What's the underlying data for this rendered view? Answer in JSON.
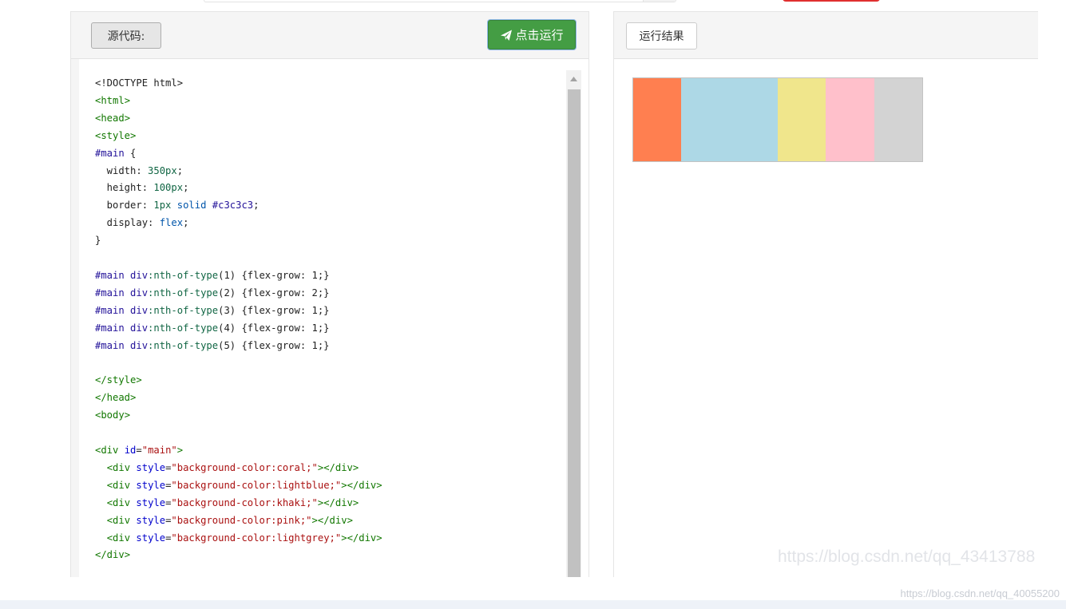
{
  "toolbar": {
    "source_label": "源代码:",
    "run_label": "点击运行",
    "result_label": "运行结果"
  },
  "editor": {
    "lines": [
      "<!DOCTYPE html>",
      "<html>",
      "<head>",
      "<style>",
      "#main {",
      "  width: 350px;",
      "  height: 100px;",
      "  border: 1px solid #c3c3c3;",
      "  display: flex;",
      "}",
      "",
      "#main div:nth-of-type(1) {flex-grow: 1;}",
      "#main div:nth-of-type(2) {flex-grow: 2;}",
      "#main div:nth-of-type(3) {flex-grow: 1;}",
      "#main div:nth-of-type(4) {flex-grow: 1;}",
      "#main div:nth-of-type(5) {flex-grow: 1;}",
      "",
      "</style>",
      "</head>",
      "<body>",
      "",
      "<div id=\"main\">",
      "  <div style=\"background-color:coral;\"></div>",
      "  <div style=\"background-color:lightblue;\"></div>",
      "  <div style=\"background-color:khaki;\"></div>",
      "  <div style=\"background-color:pink;\"></div>",
      "  <div style=\"background-color:lightgrey;\"></div>",
      "</div>"
    ]
  },
  "result": {
    "boxes": [
      {
        "color": "#ff7f50",
        "grow": 1
      },
      {
        "color": "#add8e6",
        "grow": 2
      },
      {
        "color": "#f0e68c",
        "grow": 1
      },
      {
        "color": "#ffc0cb",
        "grow": 1
      },
      {
        "color": "#d3d3d3",
        "grow": 1
      }
    ]
  },
  "watermarks": {
    "right": "https://blog.csdn.net/qq_43413788",
    "bottom": "https://blog.csdn.net/qq_40055200"
  },
  "colors": {
    "run_button": "#449d44",
    "top_red_button": "#e02f2f"
  },
  "icons": {
    "run": "paper-plane-icon",
    "scroll_up": "triangle-up-icon"
  }
}
